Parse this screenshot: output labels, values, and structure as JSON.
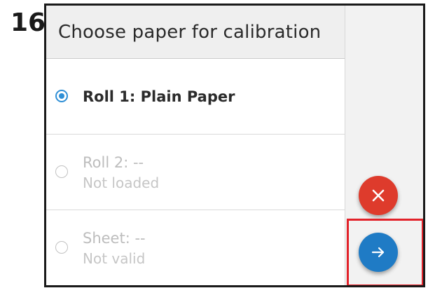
{
  "step": {
    "number": "16"
  },
  "dialog": {
    "title": "Choose paper for calibration",
    "options": [
      {
        "label": "Roll 1: Plain Paper",
        "status": "",
        "selected": true,
        "enabled": true
      },
      {
        "label": "Roll 2: --",
        "status": "Not loaded",
        "selected": false,
        "enabled": false
      },
      {
        "label": "Sheet: --",
        "status": "Not valid",
        "selected": false,
        "enabled": false
      }
    ]
  },
  "actions": {
    "cancel_icon": "close-icon",
    "next_icon": "arrow-right-icon"
  },
  "colors": {
    "accent_blue": "#1f7bc5",
    "radio_blue": "#2f8fd6",
    "cancel_red": "#de3b2c",
    "highlight_red": "#e2222a"
  }
}
